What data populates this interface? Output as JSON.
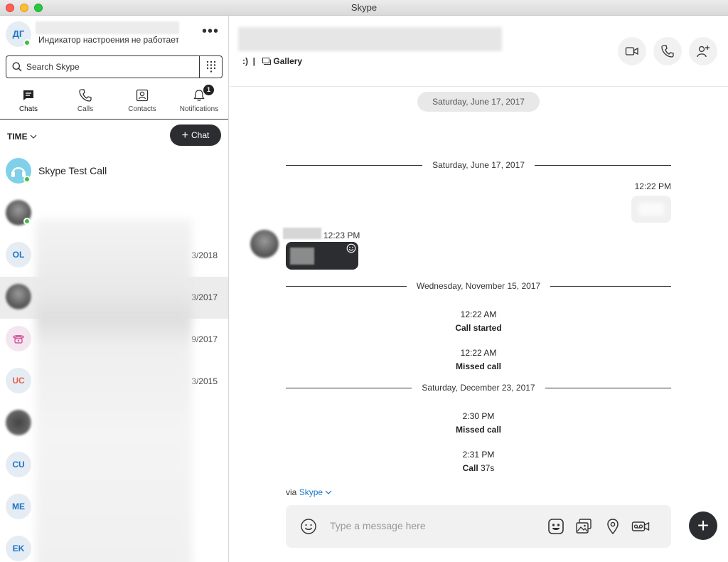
{
  "window": {
    "title": "Skype"
  },
  "profile": {
    "initials": "ДГ",
    "mood": "Индикатор настроения не работает",
    "more": "•••"
  },
  "search": {
    "placeholder": "Search Skype"
  },
  "tabs": [
    {
      "label": "Chats",
      "icon": "chat-icon"
    },
    {
      "label": "Calls",
      "icon": "phone-icon"
    },
    {
      "label": "Contacts",
      "icon": "contacts-icon"
    },
    {
      "label": "Notifications",
      "icon": "bell-icon",
      "badge": "1"
    }
  ],
  "list_header": {
    "sort_label": "TIME",
    "new_chat_label": "Chat"
  },
  "chats": [
    {
      "name": "Skype Test Call",
      "date": "",
      "avatar": "headset-icon",
      "online": true
    },
    {
      "initials": "",
      "date": "",
      "online": true
    },
    {
      "initials": "OL",
      "date": "3/2018"
    },
    {
      "initials": "",
      "date": "3/2017",
      "selected": true
    },
    {
      "initials": "",
      "date": "9/2017",
      "avatar": "phone-icon"
    },
    {
      "initials": "UC",
      "date": "3/2015"
    },
    {
      "initials": "",
      "date": ""
    },
    {
      "initials": "CU",
      "date": ""
    },
    {
      "initials": "ME",
      "date": ""
    },
    {
      "initials": "EK",
      "date": ""
    }
  ],
  "conversation": {
    "mood": ":)",
    "separator": "|",
    "gallery_label": "Gallery",
    "top_date": "Saturday, June 17, 2017",
    "separators": [
      "Saturday, June 17, 2017",
      "Wednesday, November 15, 2017",
      "Saturday, December 23, 2017"
    ],
    "outgoing_time": "12:22 PM",
    "incoming_time": "12:23 PM",
    "events": [
      {
        "time": "12:22 AM",
        "label": "Call started",
        "duration": ""
      },
      {
        "time": "12:22 AM",
        "label": "Missed call",
        "duration": ""
      },
      {
        "time": "2:30 PM",
        "label": "Missed call",
        "duration": ""
      },
      {
        "time": "2:31 PM",
        "label": "Call",
        "duration": "37s"
      }
    ],
    "via_prefix": "via",
    "via_link": "Skype"
  },
  "composer": {
    "placeholder": "Type a message here"
  },
  "colors": {
    "accent": "#1a76c9",
    "online": "#3cc13b",
    "dark_button": "#2b2d30"
  }
}
